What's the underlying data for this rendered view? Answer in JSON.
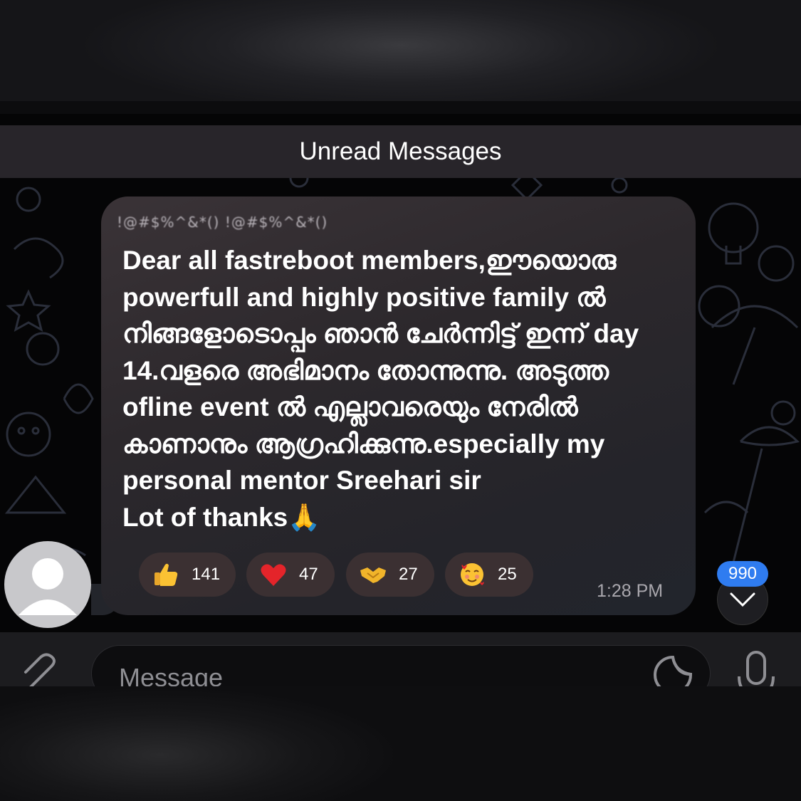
{
  "banner": {
    "label": "Unread Messages"
  },
  "message": {
    "sender": "!@#$%^&*() !@#$%^&*()",
    "text": "Dear all fastreboot members,ഈയൊരു powerfull and highly positive family ൽ നിങ്ങളോടൊപ്പം ഞാൻ ചേർന്നിട്ട് ഇന്ന് day 14.വളരെ അഭിമാനം തോന്നുന്നു. അടുത്ത ofline event ൽ എല്ലാവരെയും നേരിൽ കാണാനും ആഗ്രഹിക്കുന്നു.especially my personal mentor Sreehari sir\nLot of thanks🙏",
    "time": "1:28 PM"
  },
  "reactions": [
    {
      "icon": "thumbs-up-emoji",
      "count": "141"
    },
    {
      "icon": "red-heart-emoji",
      "count": "47"
    },
    {
      "icon": "handshake-emoji",
      "count": "27"
    },
    {
      "icon": "smiling-face-with-hearts-emoji",
      "count": "25"
    }
  ],
  "scroll": {
    "unread_count": "990"
  },
  "composer": {
    "placeholder": "Message"
  },
  "colors": {
    "accent": "#2f7cf0",
    "bubble": "#2c282c",
    "reaction_bg": "#3b3032",
    "unread_bar": "#28252a"
  }
}
